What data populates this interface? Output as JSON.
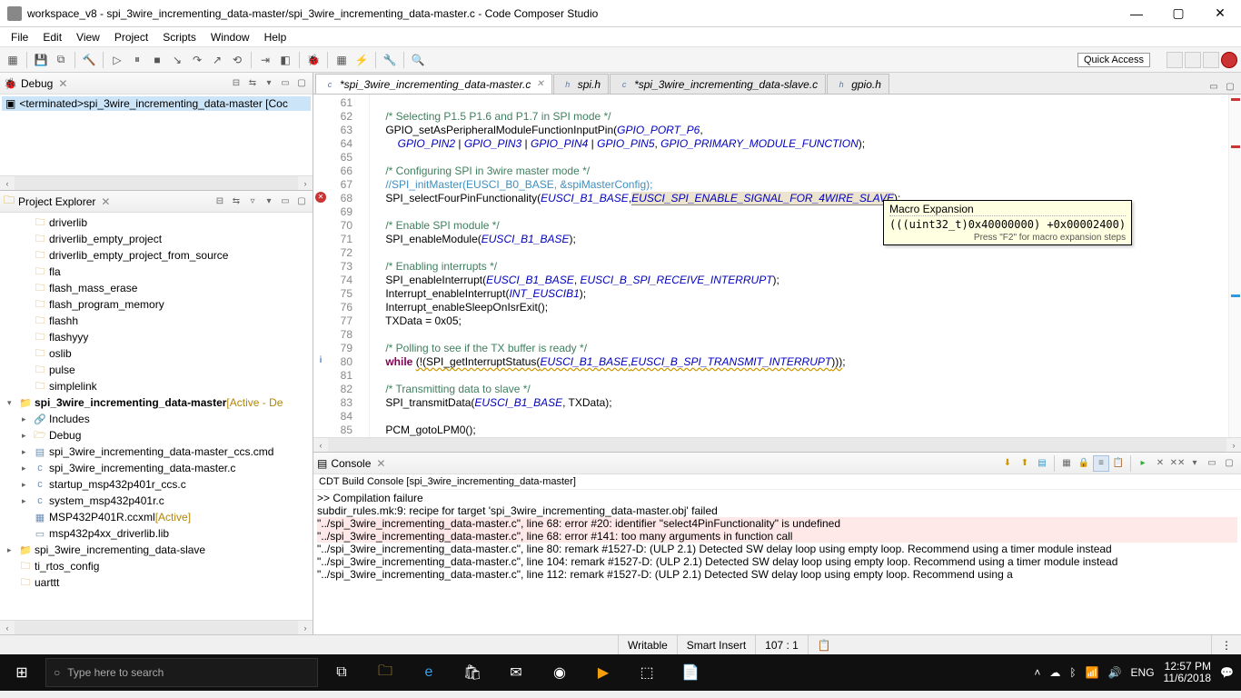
{
  "window": {
    "title": "workspace_v8 - spi_3wire_incrementing_data-master/spi_3wire_incrementing_data-master.c - Code Composer Studio"
  },
  "menubar": [
    "File",
    "Edit",
    "View",
    "Project",
    "Scripts",
    "Window",
    "Help"
  ],
  "quick_access": "Quick Access",
  "debug_view": {
    "title": "Debug",
    "item": "<terminated>spi_3wire_incrementing_data-master [Coc"
  },
  "explorer": {
    "title": "Project Explorer",
    "items": [
      {
        "level": 1,
        "icon": "folder",
        "label": "driverlib"
      },
      {
        "level": 1,
        "icon": "folder",
        "label": "driverlib_empty_project"
      },
      {
        "level": 1,
        "icon": "folder",
        "label": "driverlib_empty_project_from_source"
      },
      {
        "level": 1,
        "icon": "folder",
        "label": "fla"
      },
      {
        "level": 1,
        "icon": "folder",
        "label": "flash_mass_erase"
      },
      {
        "level": 1,
        "icon": "folder",
        "label": "flash_program_memory"
      },
      {
        "level": 1,
        "icon": "folder",
        "label": "flashh"
      },
      {
        "level": 1,
        "icon": "folder",
        "label": "flashyyy"
      },
      {
        "level": 1,
        "icon": "folder",
        "label": "oslib"
      },
      {
        "level": 1,
        "icon": "folder",
        "label": "pulse"
      },
      {
        "level": 1,
        "icon": "folder",
        "label": "simplelink"
      },
      {
        "level": 0,
        "icon": "proj",
        "arrow": "▾",
        "bold": true,
        "label": "spi_3wire_incrementing_data-master",
        "suffix": " [Active - De"
      },
      {
        "level": 1,
        "icon": "inc",
        "arrow": "▸",
        "label": "Includes"
      },
      {
        "level": 1,
        "icon": "folder-open",
        "arrow": "▸",
        "label": "Debug"
      },
      {
        "level": 1,
        "icon": "file",
        "arrow": "▸",
        "label": "spi_3wire_incrementing_data-master_ccs.cmd"
      },
      {
        "level": 1,
        "icon": "cfile",
        "arrow": "▸",
        "label": "spi_3wire_incrementing_data-master.c"
      },
      {
        "level": 1,
        "icon": "cfile",
        "arrow": "▸",
        "label": "startup_msp432p401r_ccs.c"
      },
      {
        "level": 1,
        "icon": "cfile",
        "arrow": "▸",
        "label": "system_msp432p401r.c"
      },
      {
        "level": 1,
        "icon": "xml",
        "label": "MSP432P401R.ccxml",
        "suffix": " [Active]"
      },
      {
        "level": 1,
        "icon": "lib",
        "label": "msp432p4xx_driverlib.lib"
      },
      {
        "level": 0,
        "icon": "proj",
        "arrow": "▸",
        "label": "spi_3wire_incrementing_data-slave"
      },
      {
        "level": 0,
        "icon": "folder",
        "label": "ti_rtos_config"
      },
      {
        "level": 0,
        "icon": "folder",
        "label": "uarttt"
      }
    ]
  },
  "editor": {
    "tabs": [
      {
        "label": "*spi_3wire_incrementing_data-master.c",
        "active": true,
        "close": true
      },
      {
        "label": "spi.h"
      },
      {
        "label": "*spi_3wire_incrementing_data-slave.c"
      },
      {
        "label": "gpio.h"
      }
    ],
    "first_line": 61,
    "tooltip": {
      "title": "Macro Expansion",
      "body": "(((uint32_t)0x40000000) +0x00002400)",
      "hint": "Press \"F2\" for macro expansion steps"
    }
  },
  "console": {
    "title": "Console",
    "label": "CDT Build Console [spi_3wire_incrementing_data-master]",
    "lines": [
      {
        "t": ""
      },
      {
        "t": ">> Compilation failure"
      },
      {
        "t": "subdir_rules.mk:9: recipe for target 'spi_3wire_incrementing_data-master.obj' failed"
      },
      {
        "t": "\"../spi_3wire_incrementing_data-master.c\", line 68: error #20: identifier \"select4PinFunctionality\" is undefined",
        "err": true
      },
      {
        "t": "\"../spi_3wire_incrementing_data-master.c\", line 68: error #141: too many arguments in function call",
        "err": true
      },
      {
        "t": "\"../spi_3wire_incrementing_data-master.c\", line 80: remark #1527-D: (ULP 2.1) Detected SW delay loop using empty loop. Recommend using a timer module instead"
      },
      {
        "t": "\"../spi_3wire_incrementing_data-master.c\", line 104: remark #1527-D: (ULP 2.1) Detected SW delay loop using empty loop. Recommend using a timer module instead"
      },
      {
        "t": "\"../spi_3wire_incrementing_data-master.c\", line 112: remark #1527-D: (ULP 2.1) Detected SW delay loop using empty loop. Recommend using a "
      }
    ]
  },
  "statusbar": {
    "writable": "Writable",
    "insert": "Smart Insert",
    "pos": "107 : 1"
  },
  "taskbar": {
    "search_placeholder": "Type here to search",
    "lang": "ENG",
    "time": "12:57 PM",
    "date": "11/6/2018"
  }
}
